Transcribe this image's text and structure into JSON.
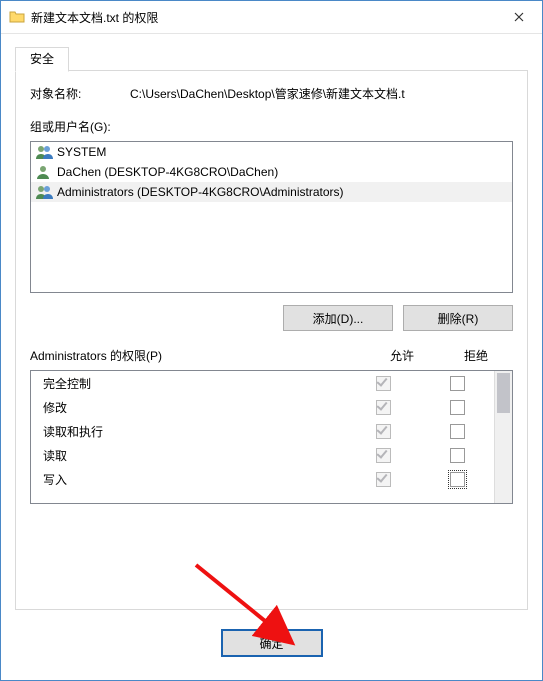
{
  "window": {
    "title": "新建文本文档.txt 的权限"
  },
  "tab": {
    "label": "安全"
  },
  "object": {
    "label": "对象名称:",
    "value": "C:\\Users\\DaChen\\Desktop\\管家速修\\新建文本文档.t"
  },
  "groups": {
    "label": "组或用户名(G):",
    "items": [
      {
        "icon": "group",
        "text": "SYSTEM"
      },
      {
        "icon": "user",
        "text": "DaChen (DESKTOP-4KG8CRO\\DaChen)"
      },
      {
        "icon": "group",
        "text": "Administrators (DESKTOP-4KG8CRO\\Administrators)"
      }
    ],
    "selected_index": 2
  },
  "buttons": {
    "add": "添加(D)...",
    "remove": "删除(R)",
    "ok": "确定"
  },
  "perm": {
    "header": "Administrators 的权限(P)",
    "col_allow": "允许",
    "col_deny": "拒绝",
    "rows": [
      {
        "name": "完全控制",
        "allow": true,
        "deny": false
      },
      {
        "name": "修改",
        "allow": true,
        "deny": false
      },
      {
        "name": "读取和执行",
        "allow": true,
        "deny": false
      },
      {
        "name": "读取",
        "allow": true,
        "deny": false
      },
      {
        "name": "写入",
        "allow": true,
        "deny": false
      }
    ]
  }
}
